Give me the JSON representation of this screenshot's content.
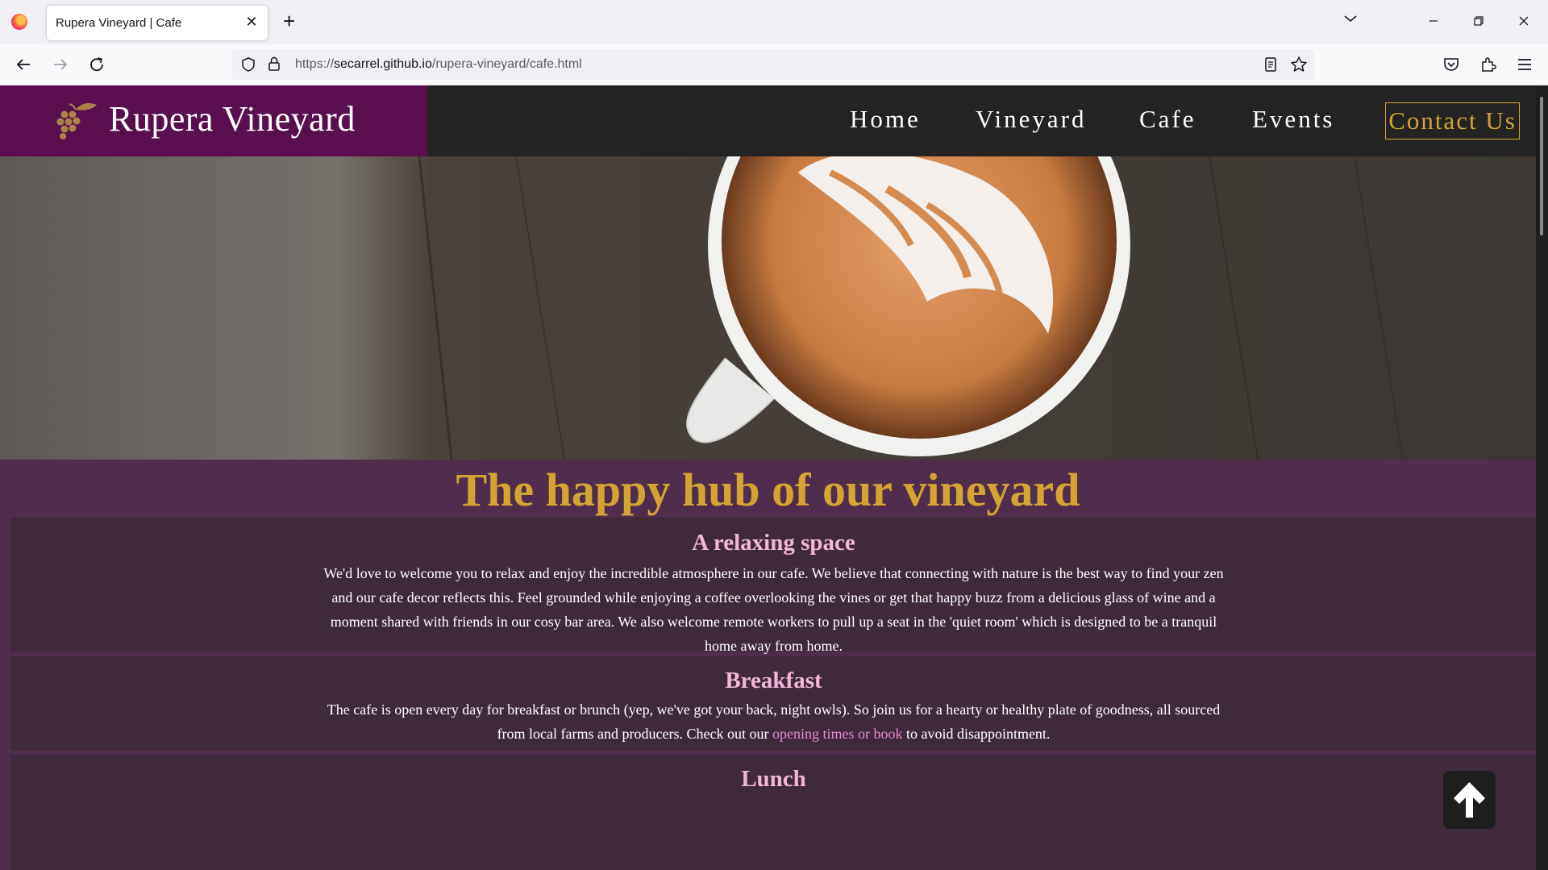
{
  "browser": {
    "tab_title": "Rupera Vineyard | Cafe",
    "url_prefix": "https://",
    "url_host": "secarrel.github.io",
    "url_path": "/rupera-vineyard/cafe.html"
  },
  "site": {
    "brand": "Rupera Vineyard",
    "nav": [
      "Home",
      "Vineyard",
      "Cafe",
      "Events"
    ],
    "contact": "Contact Us"
  },
  "headline": "The happy hub of our vineyard",
  "sections": [
    {
      "title": "A relaxing space",
      "text": "We'd love to welcome you to relax and enjoy the incredible atmosphere in our cafe. We believe that connecting with nature is the best way to find your zen and our cafe decor reflects this. Feel grounded while enjoying a coffee overlooking the vines or get that happy buzz from a delicious glass of wine and a moment shared with friends in our cosy bar area. We also welcome remote workers to pull up a seat in the 'quiet room' which is designed to be a tranquil home away from home."
    },
    {
      "title": "Breakfast",
      "text_before": "The cafe is open every day for breakfast or brunch (yep, we've got your back, night owls). So join us for a hearty or healthy plate of goodness, all sourced from local farms and producers. Check out our ",
      "link": "opening times or book",
      "text_after": " to avoid disappointment."
    },
    {
      "title": "Lunch"
    }
  ],
  "colors": {
    "brand_purple": "#5b0e4e",
    "gold": "#d4a433",
    "page_bg": "#512d4d",
    "card_bg": "#3f2a3c",
    "section_title": "#f2b6d8"
  }
}
